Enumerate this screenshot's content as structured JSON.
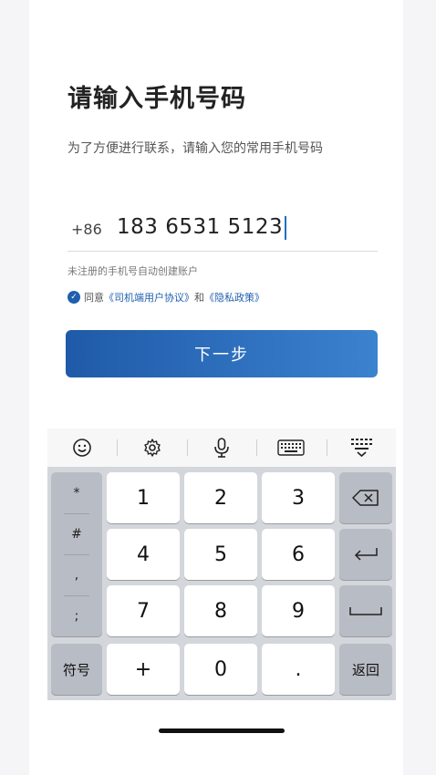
{
  "page": {
    "title": "请输入手机号码",
    "subtitle": "为了方便进行联系，请输入您的常用手机号码"
  },
  "phone": {
    "country_code": "+86",
    "value": "183 6531 5123"
  },
  "hint": "未注册的手机号自动创建账户",
  "agreement": {
    "checked": true,
    "prefix": "同意",
    "link1": "《司机端用户协议》",
    "joiner": "和",
    "link2": "《隐私政策》"
  },
  "next_button": {
    "label": "下一步"
  },
  "keyboard": {
    "toolbar_icons": [
      "emoji-icon",
      "gear-icon",
      "microphone-icon",
      "keyboard-icon",
      "hide-keyboard-icon"
    ],
    "symbols": [
      "*",
      "#",
      ",",
      ";"
    ],
    "digits": [
      "1",
      "2",
      "3",
      "4",
      "5",
      "6",
      "7",
      "8",
      "9"
    ],
    "bottom": {
      "symbols_label": "符号",
      "plus": "+",
      "zero": "0",
      "dot": ".",
      "return_label": "返回"
    }
  },
  "colors": {
    "accent": "#1f5fae",
    "button_start": "#1f5aa8",
    "button_end": "#3b82cf"
  }
}
